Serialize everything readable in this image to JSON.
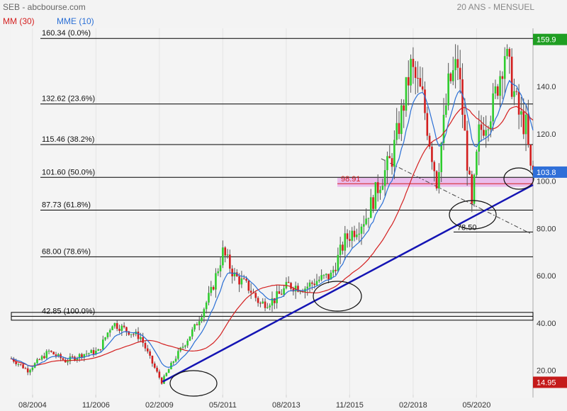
{
  "header": {
    "source": "SEB - abcbourse.com",
    "period": "20 ANS - MENSUEL",
    "ma_label": "MM (30)",
    "ema_label": "MME (10)"
  },
  "colors": {
    "candle_up": "#2ecc2e",
    "candle_down": "#d21e1e",
    "ma": "#d42020",
    "ema": "#2a6fd6",
    "trendline": "#1414b4",
    "fib_line": "#000000",
    "price_tag": "#2f6fd8",
    "high_tag": "#1f9e22",
    "low_tag": "#c41a1a",
    "support_zone": "#e8b3ea"
  },
  "chart_data": {
    "type": "candlestick",
    "title": "SEB - abcbourse.com",
    "subtitle": "20 ANS - MENSUEL",
    "x_tick_labels": [
      "08/2004",
      "11/2006",
      "02/2009",
      "05/2011",
      "08/2013",
      "11/2015",
      "02/2018",
      "05/2020"
    ],
    "y_tick_labels": [
      "20.00",
      "40.00",
      "60.00",
      "80.00",
      "100.0",
      "120.0",
      "140.0"
    ],
    "ylim": [
      8.5,
      164.6
    ],
    "price_tags": {
      "high": "159.9",
      "last": "103.8",
      "low": "14.95"
    },
    "fibonacci_levels": [
      {
        "label": "160.34  (0.0%)",
        "value": 160.34
      },
      {
        "label": "132.62  (23.6%)",
        "value": 132.62
      },
      {
        "label": "115.46  (38.2%)",
        "value": 115.46
      },
      {
        "label": "101.60  (50.0%)",
        "value": 101.6
      },
      {
        "label": "87.73  (61.8%)",
        "value": 87.73
      },
      {
        "label": "68.00  (78.6%)",
        "value": 68.0
      },
      {
        "label": "42.85  (100.0%)",
        "value": 42.85
      }
    ],
    "annotations": [
      {
        "label": "98.91",
        "value": 98.91
      },
      {
        "label": "78.50",
        "value": 78.5
      }
    ],
    "series": [
      {
        "name": "MM (30)",
        "type": "moving_average"
      },
      {
        "name": "MME (10)",
        "type": "exponential_moving_average"
      }
    ],
    "close_path": [
      [
        "2003-11",
        25
      ],
      [
        "2004-06",
        20
      ],
      [
        "2005-03",
        28
      ],
      [
        "2005-10",
        24
      ],
      [
        "2006-06",
        27
      ],
      [
        "2006-12",
        28
      ],
      [
        "2007-06",
        40
      ],
      [
        "2007-10",
        38
      ],
      [
        "2008-06",
        34
      ],
      [
        "2008-10",
        25
      ],
      [
        "2009-03",
        15
      ],
      [
        "2009-08",
        24
      ],
      [
        "2010-05",
        38
      ],
      [
        "2010-12",
        53
      ],
      [
        "2011-05",
        70
      ],
      [
        "2011-10",
        60
      ],
      [
        "2012-04",
        55
      ],
      [
        "2012-09",
        48
      ],
      [
        "2013-03",
        50
      ],
      [
        "2013-09",
        56
      ],
      [
        "2014-04",
        55
      ],
      [
        "2014-09",
        58
      ],
      [
        "2015-03",
        60
      ],
      [
        "2015-09",
        75
      ],
      [
        "2016-06",
        85
      ],
      [
        "2016-12",
        100
      ],
      [
        "2017-05",
        110
      ],
      [
        "2017-10",
        133
      ],
      [
        "2018-01",
        148
      ],
      [
        "2018-06",
        135
      ],
      [
        "2018-12",
        100
      ],
      [
        "2019-05",
        140
      ],
      [
        "2019-09",
        150
      ],
      [
        "2020-03",
        88
      ],
      [
        "2020-06",
        120
      ],
      [
        "2020-12",
        132
      ],
      [
        "2021-05",
        155
      ],
      [
        "2021-11",
        128
      ],
      [
        "2022-02",
        123
      ],
      [
        "2022-04",
        104
      ]
    ]
  }
}
